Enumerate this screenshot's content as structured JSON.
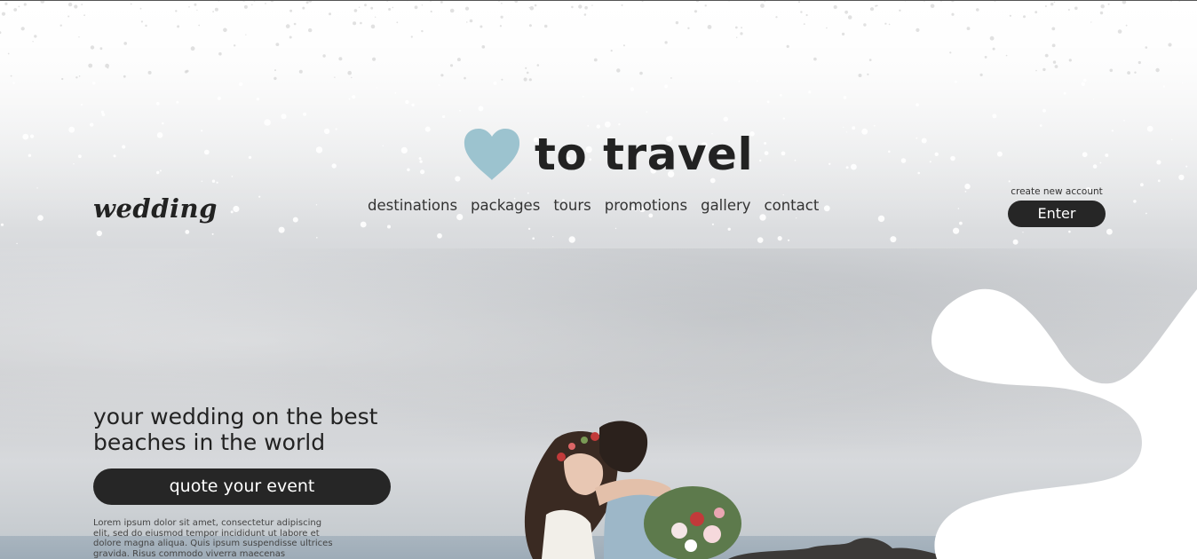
{
  "logo": {
    "text": "to travel",
    "icon": "heart-icon",
    "heart_color": "#9cc3cf"
  },
  "brand": {
    "script_text": "wedding"
  },
  "nav": {
    "items": [
      {
        "label": "destinations"
      },
      {
        "label": "packages"
      },
      {
        "label": "tours"
      },
      {
        "label": "promotions"
      },
      {
        "label": "gallery"
      },
      {
        "label": "contact"
      }
    ]
  },
  "account": {
    "create_label": "create new account",
    "enter_label": "Enter"
  },
  "hero": {
    "headline": "your wedding on the best beaches in the world",
    "cta_label": "quote your event",
    "body": "Lorem ipsum dolor sit amet, consectetur adipiscing elit, sed do eiusmod tempor incididunt ut labore et dolore magna aliqua. Quis ipsum suspendisse ultrices gravida. Risus commodo viverra maecenas"
  },
  "colors": {
    "dark": "#262626",
    "accent": "#9cc3cf",
    "text": "#222222"
  }
}
